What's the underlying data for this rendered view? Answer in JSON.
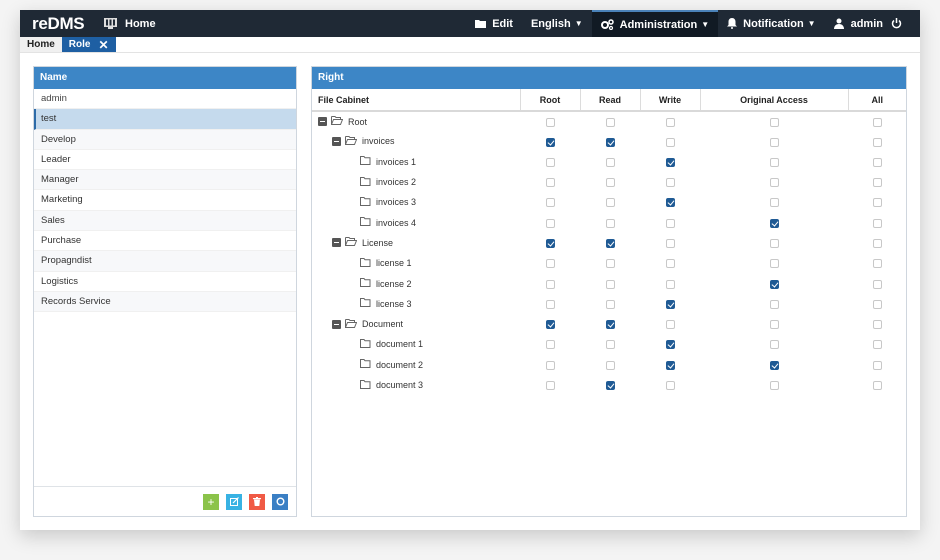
{
  "app": {
    "brand": "reDMS",
    "home": "Home"
  },
  "topnav": {
    "edit": "Edit",
    "language": "English",
    "administration": "Administration",
    "notification": "Notification",
    "user": "admin"
  },
  "tabs": [
    {
      "label": "Home",
      "active": false
    },
    {
      "label": "Role",
      "active": true
    }
  ],
  "roles": {
    "header": "Name",
    "items": [
      "admin",
      "test",
      "Develop",
      "Leader",
      "Manager",
      "Marketing",
      "Sales",
      "Purchase",
      "Propagndist",
      "Logistics",
      "Records Service"
    ],
    "selected": "test"
  },
  "rights": {
    "header": "Right",
    "columns": [
      "File Cabinet",
      "Root",
      "Read",
      "Write",
      "Original Access",
      "All"
    ],
    "rows": [
      {
        "name": "Root",
        "level": 0,
        "type": "open-folder",
        "expanded": true,
        "checks": [
          false,
          false,
          false,
          false,
          false
        ]
      },
      {
        "name": "invoices",
        "level": 1,
        "type": "open-folder",
        "expanded": true,
        "checks": [
          true,
          true,
          false,
          false,
          false
        ]
      },
      {
        "name": "invoices 1",
        "level": 2,
        "type": "folder",
        "checks": [
          false,
          false,
          true,
          false,
          false
        ]
      },
      {
        "name": "invoices 2",
        "level": 2,
        "type": "folder",
        "checks": [
          false,
          false,
          false,
          false,
          false
        ]
      },
      {
        "name": "invoices 3",
        "level": 2,
        "type": "folder",
        "checks": [
          false,
          false,
          true,
          false,
          false
        ]
      },
      {
        "name": "invoices 4",
        "level": 2,
        "type": "folder",
        "checks": [
          false,
          false,
          false,
          true,
          false
        ]
      },
      {
        "name": "License",
        "level": 1,
        "type": "open-folder",
        "expanded": true,
        "checks": [
          true,
          true,
          false,
          false,
          false
        ]
      },
      {
        "name": "license 1",
        "level": 2,
        "type": "folder",
        "checks": [
          false,
          false,
          false,
          false,
          false
        ]
      },
      {
        "name": "license 2",
        "level": 2,
        "type": "folder",
        "checks": [
          false,
          false,
          false,
          true,
          false
        ]
      },
      {
        "name": "license 3",
        "level": 2,
        "type": "folder",
        "checks": [
          false,
          false,
          true,
          false,
          false
        ]
      },
      {
        "name": "Document",
        "level": 1,
        "type": "open-folder",
        "expanded": true,
        "checks": [
          true,
          true,
          false,
          false,
          false
        ]
      },
      {
        "name": "document 1",
        "level": 2,
        "type": "folder",
        "checks": [
          false,
          false,
          true,
          false,
          false
        ]
      },
      {
        "name": "document 2",
        "level": 2,
        "type": "folder",
        "checks": [
          false,
          false,
          true,
          true,
          false
        ]
      },
      {
        "name": "document 3",
        "level": 2,
        "type": "folder",
        "checks": [
          false,
          true,
          false,
          false,
          false
        ]
      }
    ]
  },
  "actions": [
    {
      "name": "add",
      "icon": "plus-icon",
      "color": "#8bc34a"
    },
    {
      "name": "edit",
      "icon": "edit-icon",
      "color": "#38b2e3"
    },
    {
      "name": "delete",
      "icon": "trash-icon",
      "color": "#f05a45"
    },
    {
      "name": "refresh",
      "icon": "refresh-icon",
      "color": "#3a7fc4"
    }
  ],
  "colors": {
    "topbar": "#1f2935",
    "panel_header": "#3d86c6",
    "selected_row": "#c5daed",
    "checkbox_on": "#1f5a94"
  }
}
